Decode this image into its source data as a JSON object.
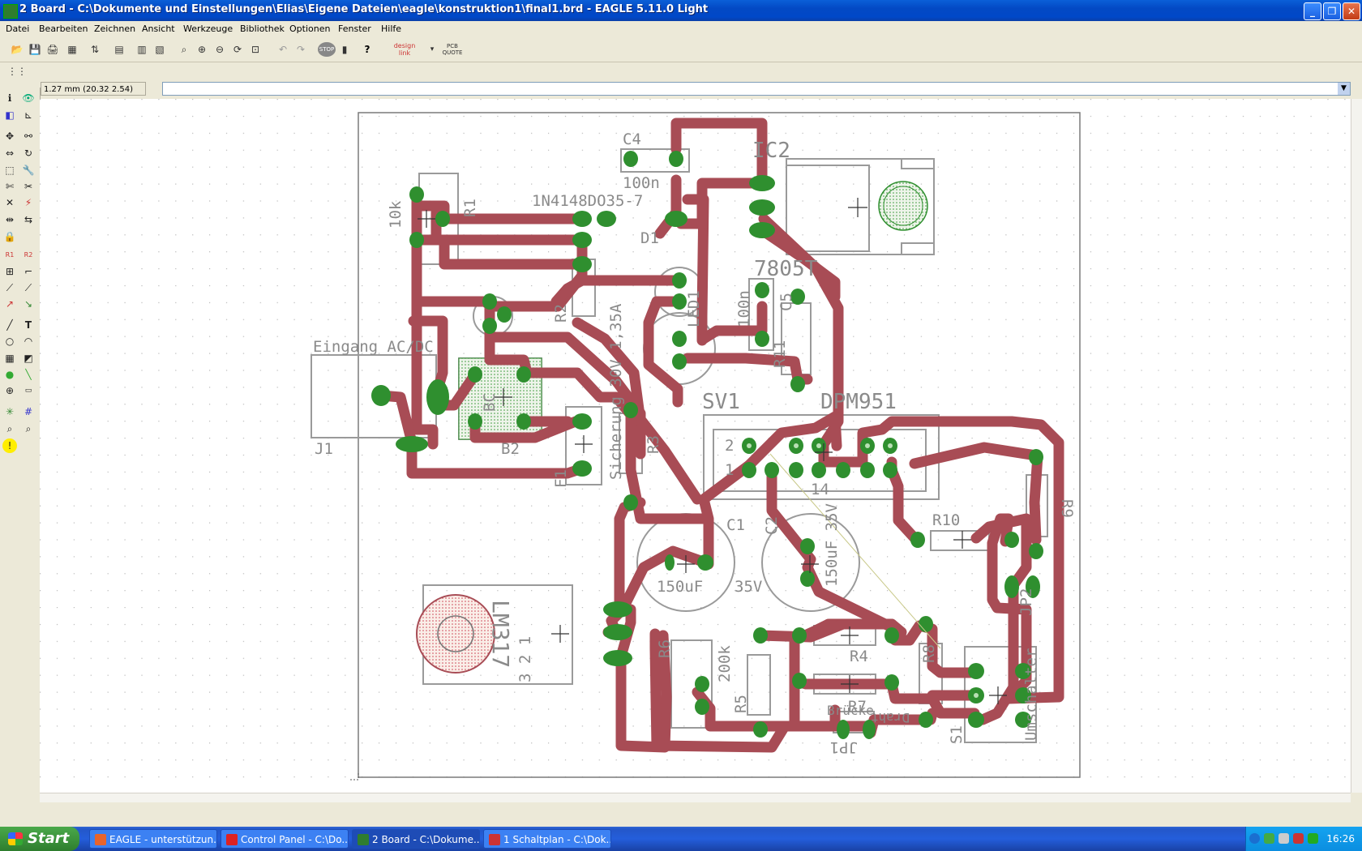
{
  "window": {
    "title": "2 Board - C:\\Dokumente und Einstellungen\\Elias\\Eigene Dateien\\eagle\\konstruktion1\\final1.brd - EAGLE 5.11.0 Light",
    "min_glyph": "_",
    "max_glyph": "❐",
    "close_glyph": "✕"
  },
  "menu": {
    "items": [
      "Datei",
      "Bearbeiten",
      "Zeichnen",
      "Ansicht",
      "Werkzeuge",
      "Bibliothek",
      "Optionen",
      "Fenster",
      "Hilfe"
    ]
  },
  "toolbar": {
    "designlink_label": "design link",
    "pcbquote_label": "PCB QUOTE",
    "stop_label": "STOP",
    "help_label": "?"
  },
  "coordinates": "1.27 mm (20.32 2.54)",
  "command_line": "",
  "board": {
    "trace_color": "#a84c55",
    "pad_color": "#2f8f2f",
    "outline_color": "#8a8a8a",
    "labels": {
      "c4": "C4",
      "c4_value": "100n",
      "ic2": "IC2",
      "ic2_value": "7805T",
      "d1_value": "1N4148DO35-7",
      "d1": "D1",
      "r1": "R1",
      "r1_value": "10k",
      "eingang": "Eingang AC/DC",
      "j1": "J1",
      "b2": "B2",
      "bc": "BC",
      "f1": "F1",
      "r2": "R2",
      "r3": "R3",
      "sicherung": "Sicherung 30V 1,35A",
      "led": "LED1",
      "r11": "R11",
      "c5": "C5",
      "c5_value": "100n",
      "sv1": "SV1",
      "dpm": "DPM951",
      "pin1": "1",
      "pin2": "2",
      "pin14": "14",
      "c1": "C1",
      "c1_value": "150uF",
      "c1_volt": "35V",
      "c2": "C2",
      "c2_value": "150uF 35V",
      "r10": "R10",
      "r9": "R9",
      "jp2": "JP2",
      "r4": "R4",
      "r5": "R5",
      "r6": "R6",
      "r7": "R7",
      "r8": "R8",
      "r6_value": "200k",
      "trimmer": "LM317",
      "jp1": "JP1",
      "jp1_value": "Draht",
      "s1": "S1",
      "umschalter": "Umschalter",
      "r7_value": "Brücke",
      "ic1_pins": "3 2 1"
    }
  },
  "taskbar": {
    "start_label": "Start",
    "tasks": [
      {
        "label": "EAGLE - unterstützun...",
        "color": "#e8642c"
      },
      {
        "label": "Control Panel - C:\\Do...",
        "color": "#d22"
      },
      {
        "label": "2 Board - C:\\Dokume...",
        "color": "#2f7d2f"
      },
      {
        "label": "1 Schaltplan - C:\\Dok...",
        "color": "#c33"
      }
    ],
    "clock": "16:26",
    "tray_icons": [
      "back-arrow-icon",
      "network-icon",
      "volume-icon",
      "security-icon",
      "d-icon"
    ]
  }
}
